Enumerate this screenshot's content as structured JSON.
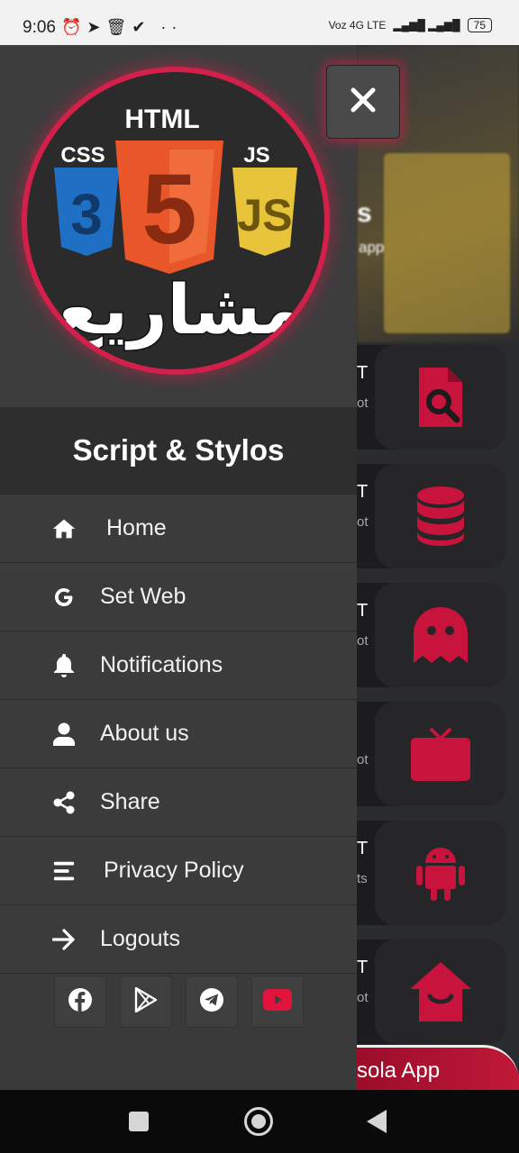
{
  "status": {
    "time": "9:06",
    "network": "Voz 4G LTE",
    "battery": "75"
  },
  "drawer": {
    "title": "Script & Stylos",
    "logo": {
      "top_text": "HTML",
      "left_text": "CSS",
      "right_text": "JS",
      "center_number": "5",
      "left_number": "3",
      "right_number": "JS",
      "arabic_text": "مشاريع"
    },
    "menu": [
      {
        "label": "Home",
        "icon": "home-icon"
      },
      {
        "label": "Set Web",
        "icon": "google-icon"
      },
      {
        "label": "Notifications",
        "icon": "bell-icon"
      },
      {
        "label": "About us",
        "icon": "user-icon"
      },
      {
        "label": "Share",
        "icon": "share-icon"
      },
      {
        "label": "Privacy Policy",
        "icon": "align-icon"
      },
      {
        "label": "Logouts",
        "icon": "arrow-right-icon"
      }
    ],
    "social": [
      "facebook-icon",
      "google-play-icon",
      "telegram-icon",
      "youtube-icon"
    ]
  },
  "background": {
    "hero_letter": "s",
    "hero_sub": "app",
    "cards": [
      {
        "letter": "T",
        "sub": "ot",
        "icon": "file-search-icon"
      },
      {
        "letter": "T",
        "sub": "ot",
        "icon": "database-icon"
      },
      {
        "letter": "T",
        "sub": "ot",
        "icon": "ghost-icon"
      },
      {
        "letter": "",
        "sub": "ot",
        "icon": "tv-icon"
      },
      {
        "letter": "T",
        "sub": "ts",
        "icon": "android-icon"
      },
      {
        "letter": "T",
        "sub": "ot",
        "icon": "home-smile-icon"
      }
    ],
    "bottom_label": "sola App"
  },
  "colors": {
    "accent": "#d2204b",
    "drawer_bg": "#3a3a3a",
    "header_band": "#2e2e2e"
  }
}
